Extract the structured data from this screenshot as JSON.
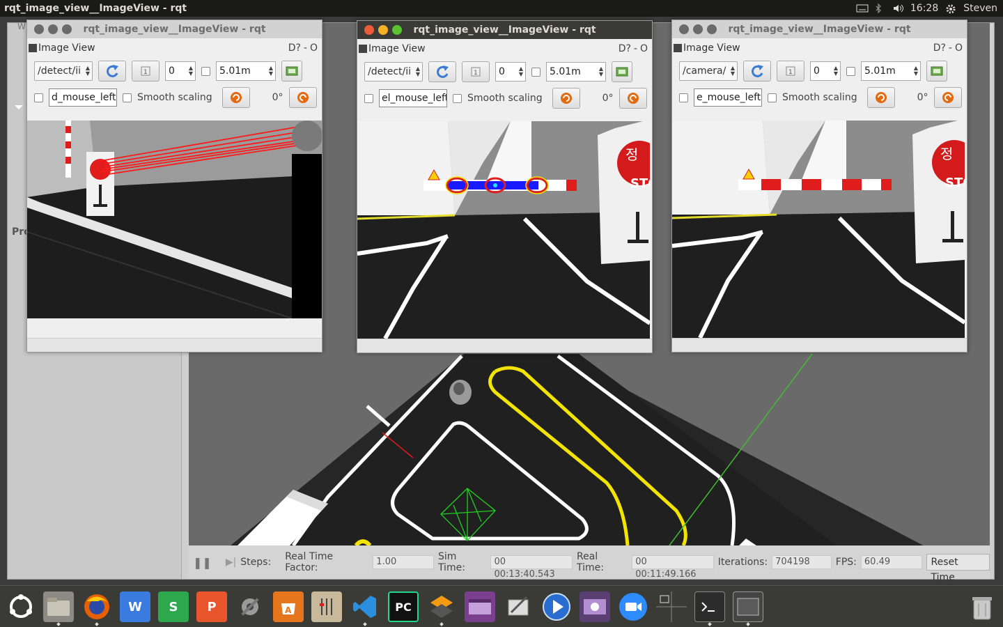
{
  "topbar": {
    "title": "rqt_image_view__ImageView - rqt",
    "time": "16:28",
    "user": "Steven"
  },
  "gazebo": {
    "left_label": "Pro",
    "corner_label": "W",
    "bottom": {
      "steps_label": "Steps:",
      "rtf_label": "Real Time Factor:",
      "rtf_value": "1.00",
      "sim_label": "Sim Time:",
      "sim_value": "00 00:13:40.543",
      "real_label": "Real Time:",
      "real_value": "00 00:11:49.166",
      "iter_label": "Iterations:",
      "iter_value": "704198",
      "fps_label": "FPS:",
      "fps_value": "60.49",
      "reset_label": "Reset Time"
    }
  },
  "windows": [
    {
      "title": "rqt_image_view__ImageView - rqt",
      "panel": "Image View",
      "help": "D?",
      "topic": "/detect/ii",
      "spin1": "0",
      "spin2": "5.01m",
      "mouse_field": "d_mouse_left",
      "smooth": "Smooth scaling",
      "rotation": "0°"
    },
    {
      "title": "rqt_image_view__ImageView - rqt",
      "panel": "Image View",
      "help": "D?",
      "topic": "/detect/ii",
      "spin1": "0",
      "spin2": "5.01m",
      "mouse_field": "el_mouse_left",
      "smooth": "Smooth scaling",
      "rotation": "0°"
    },
    {
      "title": "rqt_image_view__ImageView - rqt",
      "panel": "Image View",
      "help": "D?",
      "topic": "/camera/",
      "spin1": "0",
      "spin2": "5.01m",
      "mouse_field": "e_mouse_left",
      "smooth": "Smooth scaling",
      "rotation": "0°"
    }
  ],
  "sign_text": {
    "korean": "정",
    "stop": "STO",
    "stop_small": "STOP"
  },
  "dock": {
    "items": [
      "ubuntu-icon",
      "files-icon",
      "firefox-icon",
      "wps-writer-icon",
      "wps-spreadsheet-icon",
      "wps-presentation-icon",
      "settings-icon",
      "software-center-icon",
      "pcb-tool-icon",
      "vscode-icon",
      "pycharm-icon",
      "layers-icon",
      "video-icon",
      "screenshot-icon",
      "media-player-icon",
      "video-editor-icon",
      "zoom-icon",
      "workspace-icon",
      "terminal-icon",
      "window-icon",
      "trash-icon"
    ],
    "labels": {
      "wps_writer": "W",
      "wps_sheet": "S",
      "wps_pres": "P",
      "pycharm": "PC"
    }
  },
  "colors": {
    "accent_red": "#e01c1c",
    "accent_yellow": "#f2e300",
    "ros_orange": "#e46a12"
  }
}
